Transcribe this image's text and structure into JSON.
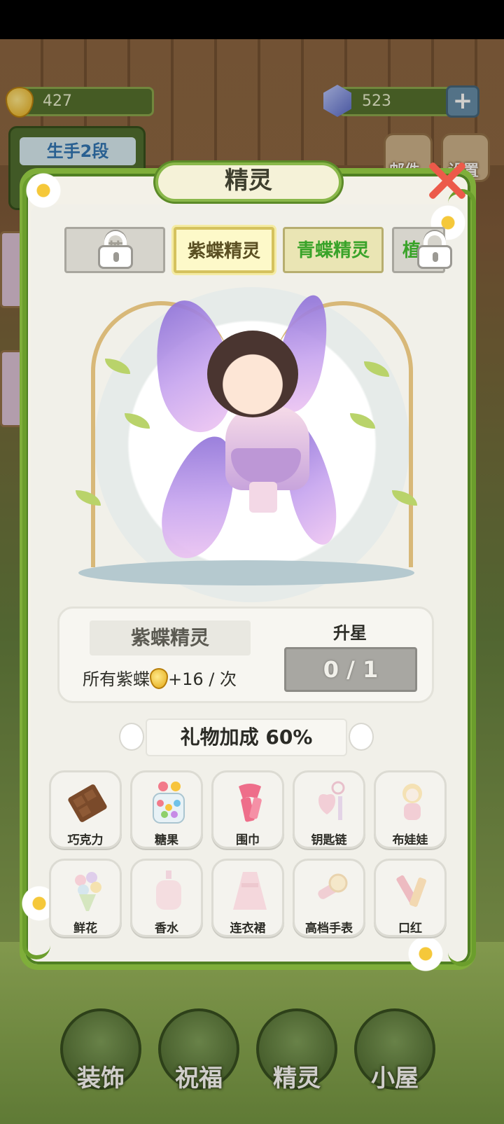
{
  "resources": {
    "gold": "427",
    "gems": "523"
  },
  "rank": {
    "label": "生手2段"
  },
  "top_buttons": {
    "mail": "邮件",
    "settings": "设置"
  },
  "modal": {
    "title": "精灵",
    "tabs": [
      {
        "label": "茶",
        "state": "locked"
      },
      {
        "label": "紫蝶精灵",
        "state": "selected"
      },
      {
        "label": "青蝶精灵",
        "state": "unlocked"
      },
      {
        "label": "植",
        "state": "locked"
      }
    ],
    "fairy": {
      "name": "紫蝶精灵",
      "bonus_text_prefix": "所有紫蝶",
      "bonus_text_suffix": "+16 / 次",
      "star_label": "升星",
      "star_progress": "0 / 1"
    },
    "gift_bonus": "礼物加成 60%",
    "gifts": [
      {
        "label": "巧克力",
        "icon": "chocolate-icon",
        "owned": true
      },
      {
        "label": "糖果",
        "icon": "candy-jar-icon",
        "owned": true
      },
      {
        "label": "围巾",
        "icon": "scarf-icon",
        "owned": true
      },
      {
        "label": "钥匙链",
        "icon": "keychain-icon",
        "owned": false
      },
      {
        "label": "布娃娃",
        "icon": "doll-icon",
        "owned": false
      },
      {
        "label": "鲜花",
        "icon": "bouquet-icon",
        "owned": false
      },
      {
        "label": "香水",
        "icon": "perfume-icon",
        "owned": false
      },
      {
        "label": "连衣裙",
        "icon": "dress-icon",
        "owned": false
      },
      {
        "label": "高档手表",
        "icon": "watch-icon",
        "owned": false
      },
      {
        "label": "口红",
        "icon": "lipstick-icon",
        "owned": false
      }
    ]
  },
  "bottom_nav": [
    {
      "label": "装饰"
    },
    {
      "label": "祝福"
    },
    {
      "label": "精灵"
    },
    {
      "label": "小屋"
    }
  ],
  "colors": {
    "accent_green": "#7fae3a",
    "close_red": "#ec5a4a",
    "selected_tab": "#fdf9c9",
    "unlocked_tab_text": "#39a329"
  }
}
